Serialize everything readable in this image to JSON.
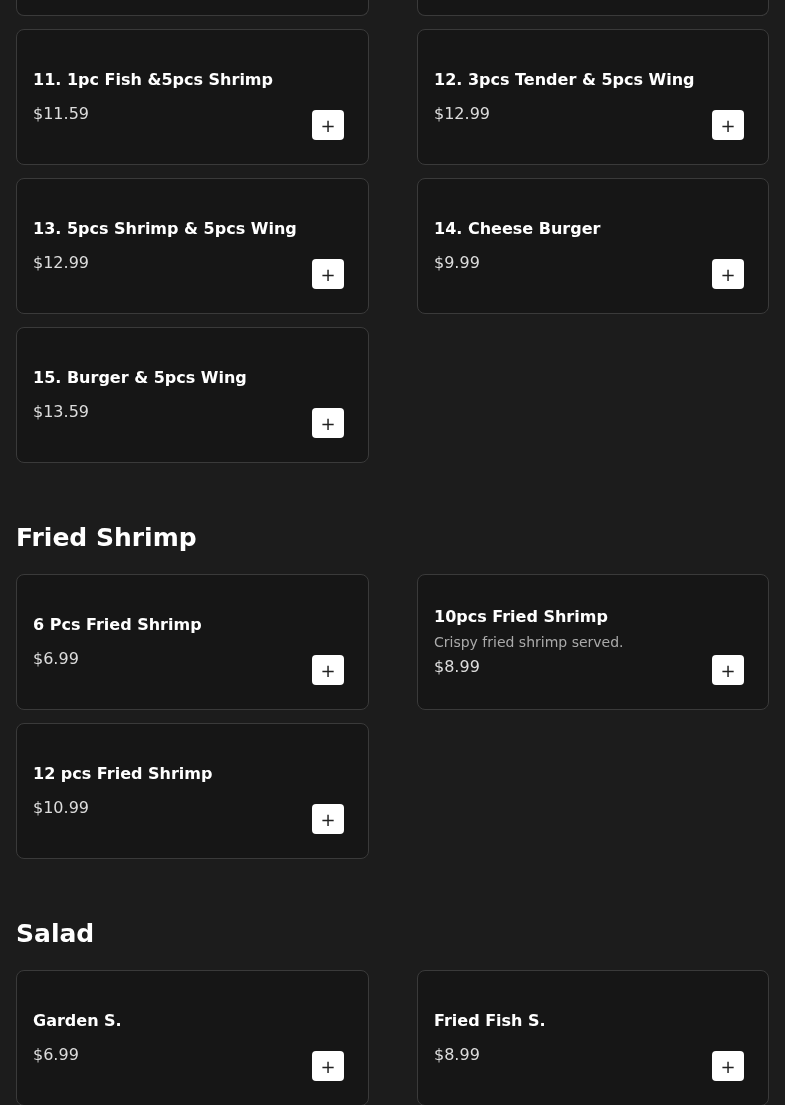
{
  "sections": [
    {
      "items": [
        {
          "name": "11. 1pc Fish &5pcs Shrimp",
          "price": "$11.59",
          "add_label": "+"
        },
        {
          "name": "12. 3pcs Tender & 5pcs Wing",
          "price": "$12.99",
          "add_label": "+"
        },
        {
          "name": "13. 5pcs Shrimp & 5pcs Wing",
          "price": "$12.99",
          "add_label": "+"
        },
        {
          "name": "14. Cheese Burger",
          "price": "$9.99",
          "add_label": "+"
        },
        {
          "name": "15. Burger & 5pcs Wing",
          "price": "$13.59",
          "add_label": "+"
        }
      ]
    },
    {
      "title": "Fried Shrimp",
      "items": [
        {
          "name": "6 Pcs Fried Shrimp",
          "price": "$6.99",
          "add_label": "+"
        },
        {
          "name": "10pcs Fried Shrimp",
          "description": "Crispy fried shrimp served.",
          "price": "$8.99",
          "add_label": "+"
        },
        {
          "name": "12 pcs Fried Shrimp",
          "price": "$10.99",
          "add_label": "+"
        }
      ]
    },
    {
      "title": "Salad",
      "items": [
        {
          "name": "Garden S.",
          "price": "$6.99",
          "add_label": "+"
        },
        {
          "name": "Fried Fish S.",
          "price": "$8.99",
          "add_label": "+"
        }
      ]
    }
  ]
}
